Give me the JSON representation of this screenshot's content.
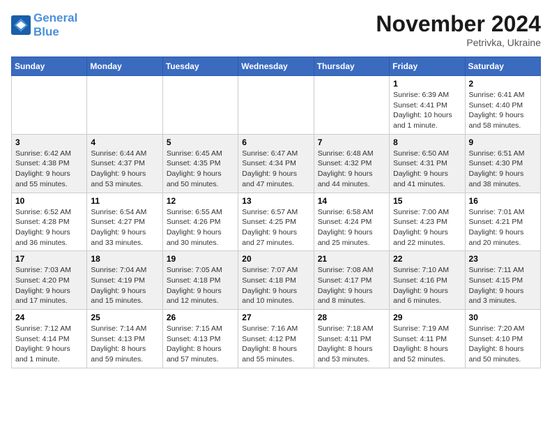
{
  "header": {
    "logo_line1": "General",
    "logo_line2": "Blue",
    "month": "November 2024",
    "location": "Petrivka, Ukraine"
  },
  "days_of_week": [
    "Sunday",
    "Monday",
    "Tuesday",
    "Wednesday",
    "Thursday",
    "Friday",
    "Saturday"
  ],
  "weeks": [
    [
      {
        "day": "",
        "info": ""
      },
      {
        "day": "",
        "info": ""
      },
      {
        "day": "",
        "info": ""
      },
      {
        "day": "",
        "info": ""
      },
      {
        "day": "",
        "info": ""
      },
      {
        "day": "1",
        "info": "Sunrise: 6:39 AM\nSunset: 4:41 PM\nDaylight: 10 hours\nand 1 minute."
      },
      {
        "day": "2",
        "info": "Sunrise: 6:41 AM\nSunset: 4:40 PM\nDaylight: 9 hours\nand 58 minutes."
      }
    ],
    [
      {
        "day": "3",
        "info": "Sunrise: 6:42 AM\nSunset: 4:38 PM\nDaylight: 9 hours\nand 55 minutes."
      },
      {
        "day": "4",
        "info": "Sunrise: 6:44 AM\nSunset: 4:37 PM\nDaylight: 9 hours\nand 53 minutes."
      },
      {
        "day": "5",
        "info": "Sunrise: 6:45 AM\nSunset: 4:35 PM\nDaylight: 9 hours\nand 50 minutes."
      },
      {
        "day": "6",
        "info": "Sunrise: 6:47 AM\nSunset: 4:34 PM\nDaylight: 9 hours\nand 47 minutes."
      },
      {
        "day": "7",
        "info": "Sunrise: 6:48 AM\nSunset: 4:32 PM\nDaylight: 9 hours\nand 44 minutes."
      },
      {
        "day": "8",
        "info": "Sunrise: 6:50 AM\nSunset: 4:31 PM\nDaylight: 9 hours\nand 41 minutes."
      },
      {
        "day": "9",
        "info": "Sunrise: 6:51 AM\nSunset: 4:30 PM\nDaylight: 9 hours\nand 38 minutes."
      }
    ],
    [
      {
        "day": "10",
        "info": "Sunrise: 6:52 AM\nSunset: 4:28 PM\nDaylight: 9 hours\nand 36 minutes."
      },
      {
        "day": "11",
        "info": "Sunrise: 6:54 AM\nSunset: 4:27 PM\nDaylight: 9 hours\nand 33 minutes."
      },
      {
        "day": "12",
        "info": "Sunrise: 6:55 AM\nSunset: 4:26 PM\nDaylight: 9 hours\nand 30 minutes."
      },
      {
        "day": "13",
        "info": "Sunrise: 6:57 AM\nSunset: 4:25 PM\nDaylight: 9 hours\nand 27 minutes."
      },
      {
        "day": "14",
        "info": "Sunrise: 6:58 AM\nSunset: 4:24 PM\nDaylight: 9 hours\nand 25 minutes."
      },
      {
        "day": "15",
        "info": "Sunrise: 7:00 AM\nSunset: 4:23 PM\nDaylight: 9 hours\nand 22 minutes."
      },
      {
        "day": "16",
        "info": "Sunrise: 7:01 AM\nSunset: 4:21 PM\nDaylight: 9 hours\nand 20 minutes."
      }
    ],
    [
      {
        "day": "17",
        "info": "Sunrise: 7:03 AM\nSunset: 4:20 PM\nDaylight: 9 hours\nand 17 minutes."
      },
      {
        "day": "18",
        "info": "Sunrise: 7:04 AM\nSunset: 4:19 PM\nDaylight: 9 hours\nand 15 minutes."
      },
      {
        "day": "19",
        "info": "Sunrise: 7:05 AM\nSunset: 4:18 PM\nDaylight: 9 hours\nand 12 minutes."
      },
      {
        "day": "20",
        "info": "Sunrise: 7:07 AM\nSunset: 4:18 PM\nDaylight: 9 hours\nand 10 minutes."
      },
      {
        "day": "21",
        "info": "Sunrise: 7:08 AM\nSunset: 4:17 PM\nDaylight: 9 hours\nand 8 minutes."
      },
      {
        "day": "22",
        "info": "Sunrise: 7:10 AM\nSunset: 4:16 PM\nDaylight: 9 hours\nand 6 minutes."
      },
      {
        "day": "23",
        "info": "Sunrise: 7:11 AM\nSunset: 4:15 PM\nDaylight: 9 hours\nand 3 minutes."
      }
    ],
    [
      {
        "day": "24",
        "info": "Sunrise: 7:12 AM\nSunset: 4:14 PM\nDaylight: 9 hours\nand 1 minute."
      },
      {
        "day": "25",
        "info": "Sunrise: 7:14 AM\nSunset: 4:13 PM\nDaylight: 8 hours\nand 59 minutes."
      },
      {
        "day": "26",
        "info": "Sunrise: 7:15 AM\nSunset: 4:13 PM\nDaylight: 8 hours\nand 57 minutes."
      },
      {
        "day": "27",
        "info": "Sunrise: 7:16 AM\nSunset: 4:12 PM\nDaylight: 8 hours\nand 55 minutes."
      },
      {
        "day": "28",
        "info": "Sunrise: 7:18 AM\nSunset: 4:11 PM\nDaylight: 8 hours\nand 53 minutes."
      },
      {
        "day": "29",
        "info": "Sunrise: 7:19 AM\nSunset: 4:11 PM\nDaylight: 8 hours\nand 52 minutes."
      },
      {
        "day": "30",
        "info": "Sunrise: 7:20 AM\nSunset: 4:10 PM\nDaylight: 8 hours\nand 50 minutes."
      }
    ]
  ]
}
